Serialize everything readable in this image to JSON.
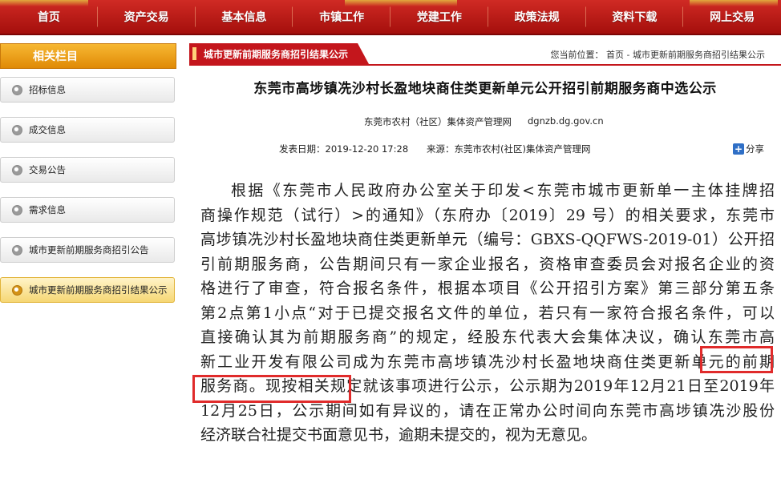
{
  "nav": {
    "items": [
      "首页",
      "资产交易",
      "基本信息",
      "市镇工作",
      "党建工作",
      "政策法规",
      "资料下载",
      "网上交易"
    ]
  },
  "sidebar": {
    "header": "相关栏目",
    "items": [
      {
        "label": "招标信息",
        "active": false
      },
      {
        "label": "成交信息",
        "active": false
      },
      {
        "label": "交易公告",
        "active": false
      },
      {
        "label": "需求信息",
        "active": false
      },
      {
        "label": "城市更新前期服务商招引公告",
        "active": false
      },
      {
        "label": "城市更新前期服务商招引结果公示",
        "active": true
      }
    ]
  },
  "content": {
    "section_tab": "城市更新前期服务商招引结果公示",
    "breadcrumb": {
      "prefix": "您当前位置：",
      "path": "首页 - 城市更新前期服务商招引结果公示"
    }
  },
  "article": {
    "title": "东莞市高埗镇冼沙村长盈地块商住类更新单元公开招引前期服务商中选公示",
    "source_org": "东莞市农村（社区）集体资产管理网",
    "source_url": "dgnzb.dg.gov.cn",
    "publish_label": "发表日期：",
    "publish_date": "2019-12-20 17:28",
    "origin_label": "来源：",
    "origin": "东莞市农村(社区)集体资产管理网",
    "share_label": "分享",
    "body_lines": [
      "根据《东莞市人民政府办公室关于印发<东莞市城市更新单一主体挂牌招",
      "商操作规范（试行）>的通知》（东府办〔2019〕29 号）的相关要求，东莞市",
      "高埗镇冼沙村长盈地块商住类更新单元（编号：GBXS-QQFWS-2019-01）公开招",
      "引前期服务商，公告期间只有一家企业报名，资格审查委员会对报名企业的资",
      "格进行了审查，符合报名条件，根据本项目《公开招引方案》第三部分第五条",
      "第2点第1小点“对于已提交报名文件的单位，若只有一家符合报名条件，可以",
      "直接确认其为前期服务商”的规定，经股东代表大会集体决议，确认东莞市高",
      "新工业开发有限公司成为东莞市高埗镇冼沙村长盈地块商住类更新单元的前期",
      "服务商。现按相关规定就该事项进行公示，公示期为2019年12月21日至2019年",
      "12月25日，公示期间如有异议的，请在正常办公时间向东莞市高埗镇冼沙股份",
      "经济联合社提交书面意见书，逾期未提交的，视为无意见。"
    ]
  }
}
